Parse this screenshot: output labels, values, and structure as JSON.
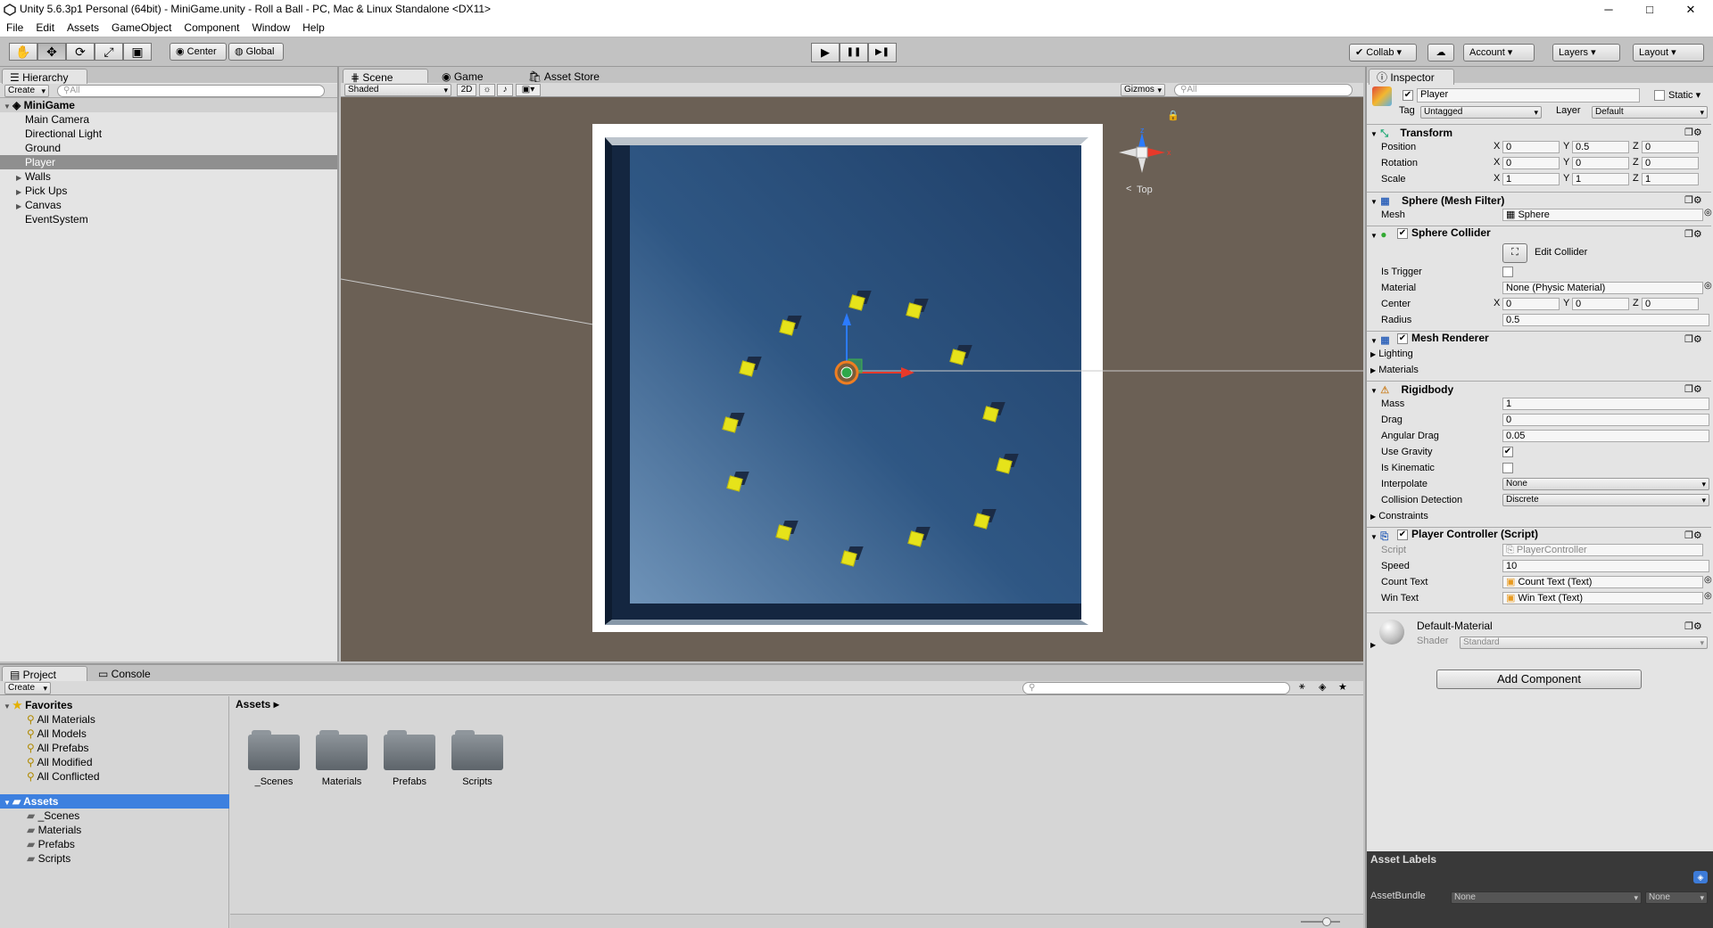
{
  "title": "Unity 5.6.3p1 Personal (64bit) - MiniGame.unity - Roll a Ball - PC, Mac & Linux Standalone <DX11>",
  "window_controls": {
    "minimize": "─",
    "maximize": "□",
    "close": "✕"
  },
  "menu": [
    "File",
    "Edit",
    "Assets",
    "GameObject",
    "Component",
    "Window",
    "Help"
  ],
  "toolbar": {
    "tools": [
      "hand-tool",
      "move-tool",
      "rotate-tool",
      "scale-tool",
      "rect-tool"
    ],
    "tool_glyphs": [
      "✋",
      "✥",
      "⟳",
      "⤢",
      "▣"
    ],
    "pivot": "Center",
    "space": "Global",
    "play": "▶",
    "pause": "❚❚",
    "step": "▶❚",
    "collab": "Collab ▾",
    "account": "Account",
    "layers": "Layers",
    "layout": "Layout"
  },
  "hierarchy": {
    "tab": "Hierarchy",
    "create": "Create",
    "search_placeholder": "All",
    "scene": "MiniGame",
    "items": [
      {
        "label": "Main Camera",
        "expandable": false,
        "selected": false
      },
      {
        "label": "Directional Light",
        "expandable": false,
        "selected": false
      },
      {
        "label": "Ground",
        "expandable": false,
        "selected": false
      },
      {
        "label": "Player",
        "expandable": false,
        "selected": true
      },
      {
        "label": "Walls",
        "expandable": true,
        "selected": false
      },
      {
        "label": "Pick Ups",
        "expandable": true,
        "selected": false
      },
      {
        "label": "Canvas",
        "expandable": true,
        "selected": false
      },
      {
        "label": "EventSystem",
        "expandable": false,
        "selected": false
      }
    ]
  },
  "scene_view": {
    "tabs": [
      "Scene",
      "Game",
      "Asset Store"
    ],
    "shading": "Shaded",
    "mode_2d": "2D",
    "gizmos": "Gizmos",
    "search_placeholder": "All",
    "gizmo_label": "Top",
    "colors": {
      "background": "#6b6055",
      "ground_dark": "#1f3f68",
      "ground_light": "#5f82a8",
      "pickup": "#e6e31a"
    }
  },
  "inspector": {
    "tab": "Inspector",
    "object_name": "Player",
    "static_label": "Static",
    "tag_label": "Tag",
    "tag": "Untagged",
    "layer_label": "Layer",
    "layer": "Default",
    "transform": {
      "title": "Transform",
      "position_label": "Position",
      "rotation_label": "Rotation",
      "scale_label": "Scale",
      "position": [
        "0",
        "0.5",
        "0"
      ],
      "rotation": [
        "0",
        "0",
        "0"
      ],
      "scale": [
        "1",
        "1",
        "1"
      ]
    },
    "mesh_filter": {
      "title": "Sphere (Mesh Filter)",
      "mesh_label": "Mesh",
      "mesh": "Sphere"
    },
    "sphere_collider": {
      "title": "Sphere Collider",
      "edit_collider": "Edit Collider",
      "is_trigger_label": "Is Trigger",
      "material_label": "Material",
      "material": "None (Physic Material)",
      "center_label": "Center",
      "center": [
        "0",
        "0",
        "0"
      ],
      "radius_label": "Radius",
      "radius": "0.5"
    },
    "mesh_renderer": {
      "title": "Mesh Renderer",
      "lighting": "Lighting",
      "materials": "Materials"
    },
    "rigidbody": {
      "title": "Rigidbody",
      "mass_label": "Mass",
      "mass": "1",
      "drag_label": "Drag",
      "drag": "0",
      "angular_drag_label": "Angular Drag",
      "angular_drag": "0.05",
      "use_gravity_label": "Use Gravity",
      "is_kinematic_label": "Is Kinematic",
      "interpolate_label": "Interpolate",
      "interpolate": "None",
      "collision_label": "Collision Detection",
      "collision": "Discrete",
      "constraints": "Constraints"
    },
    "player_controller": {
      "title": "Player Controller (Script)",
      "script_label": "Script",
      "script": "PlayerController",
      "speed_label": "Speed",
      "speed": "10",
      "count_text_label": "Count Text",
      "count_text": "Count Text (Text)",
      "win_text_label": "Win Text",
      "win_text": "Win Text (Text)"
    },
    "material": {
      "name": "Default-Material",
      "shader_label": "Shader",
      "shader": "Standard"
    },
    "add_component": "Add Component",
    "asset_labels": "Asset Labels",
    "asset_bundle_label": "AssetBundle",
    "asset_bundle": "None",
    "asset_bundle_variant": "None"
  },
  "project": {
    "tabs": [
      "Project",
      "Console"
    ],
    "create": "Create",
    "favorites_title": "Favorites",
    "favorites": [
      "All Materials",
      "All Models",
      "All Prefabs",
      "All Modified",
      "All Conflicted"
    ],
    "assets_title": "Assets",
    "asset_tree": [
      "_Scenes",
      "Materials",
      "Prefabs",
      "Scripts"
    ],
    "breadcrumb": "Assets ▸",
    "folders": [
      "_Scenes",
      "Materials",
      "Prefabs",
      "Scripts"
    ]
  }
}
